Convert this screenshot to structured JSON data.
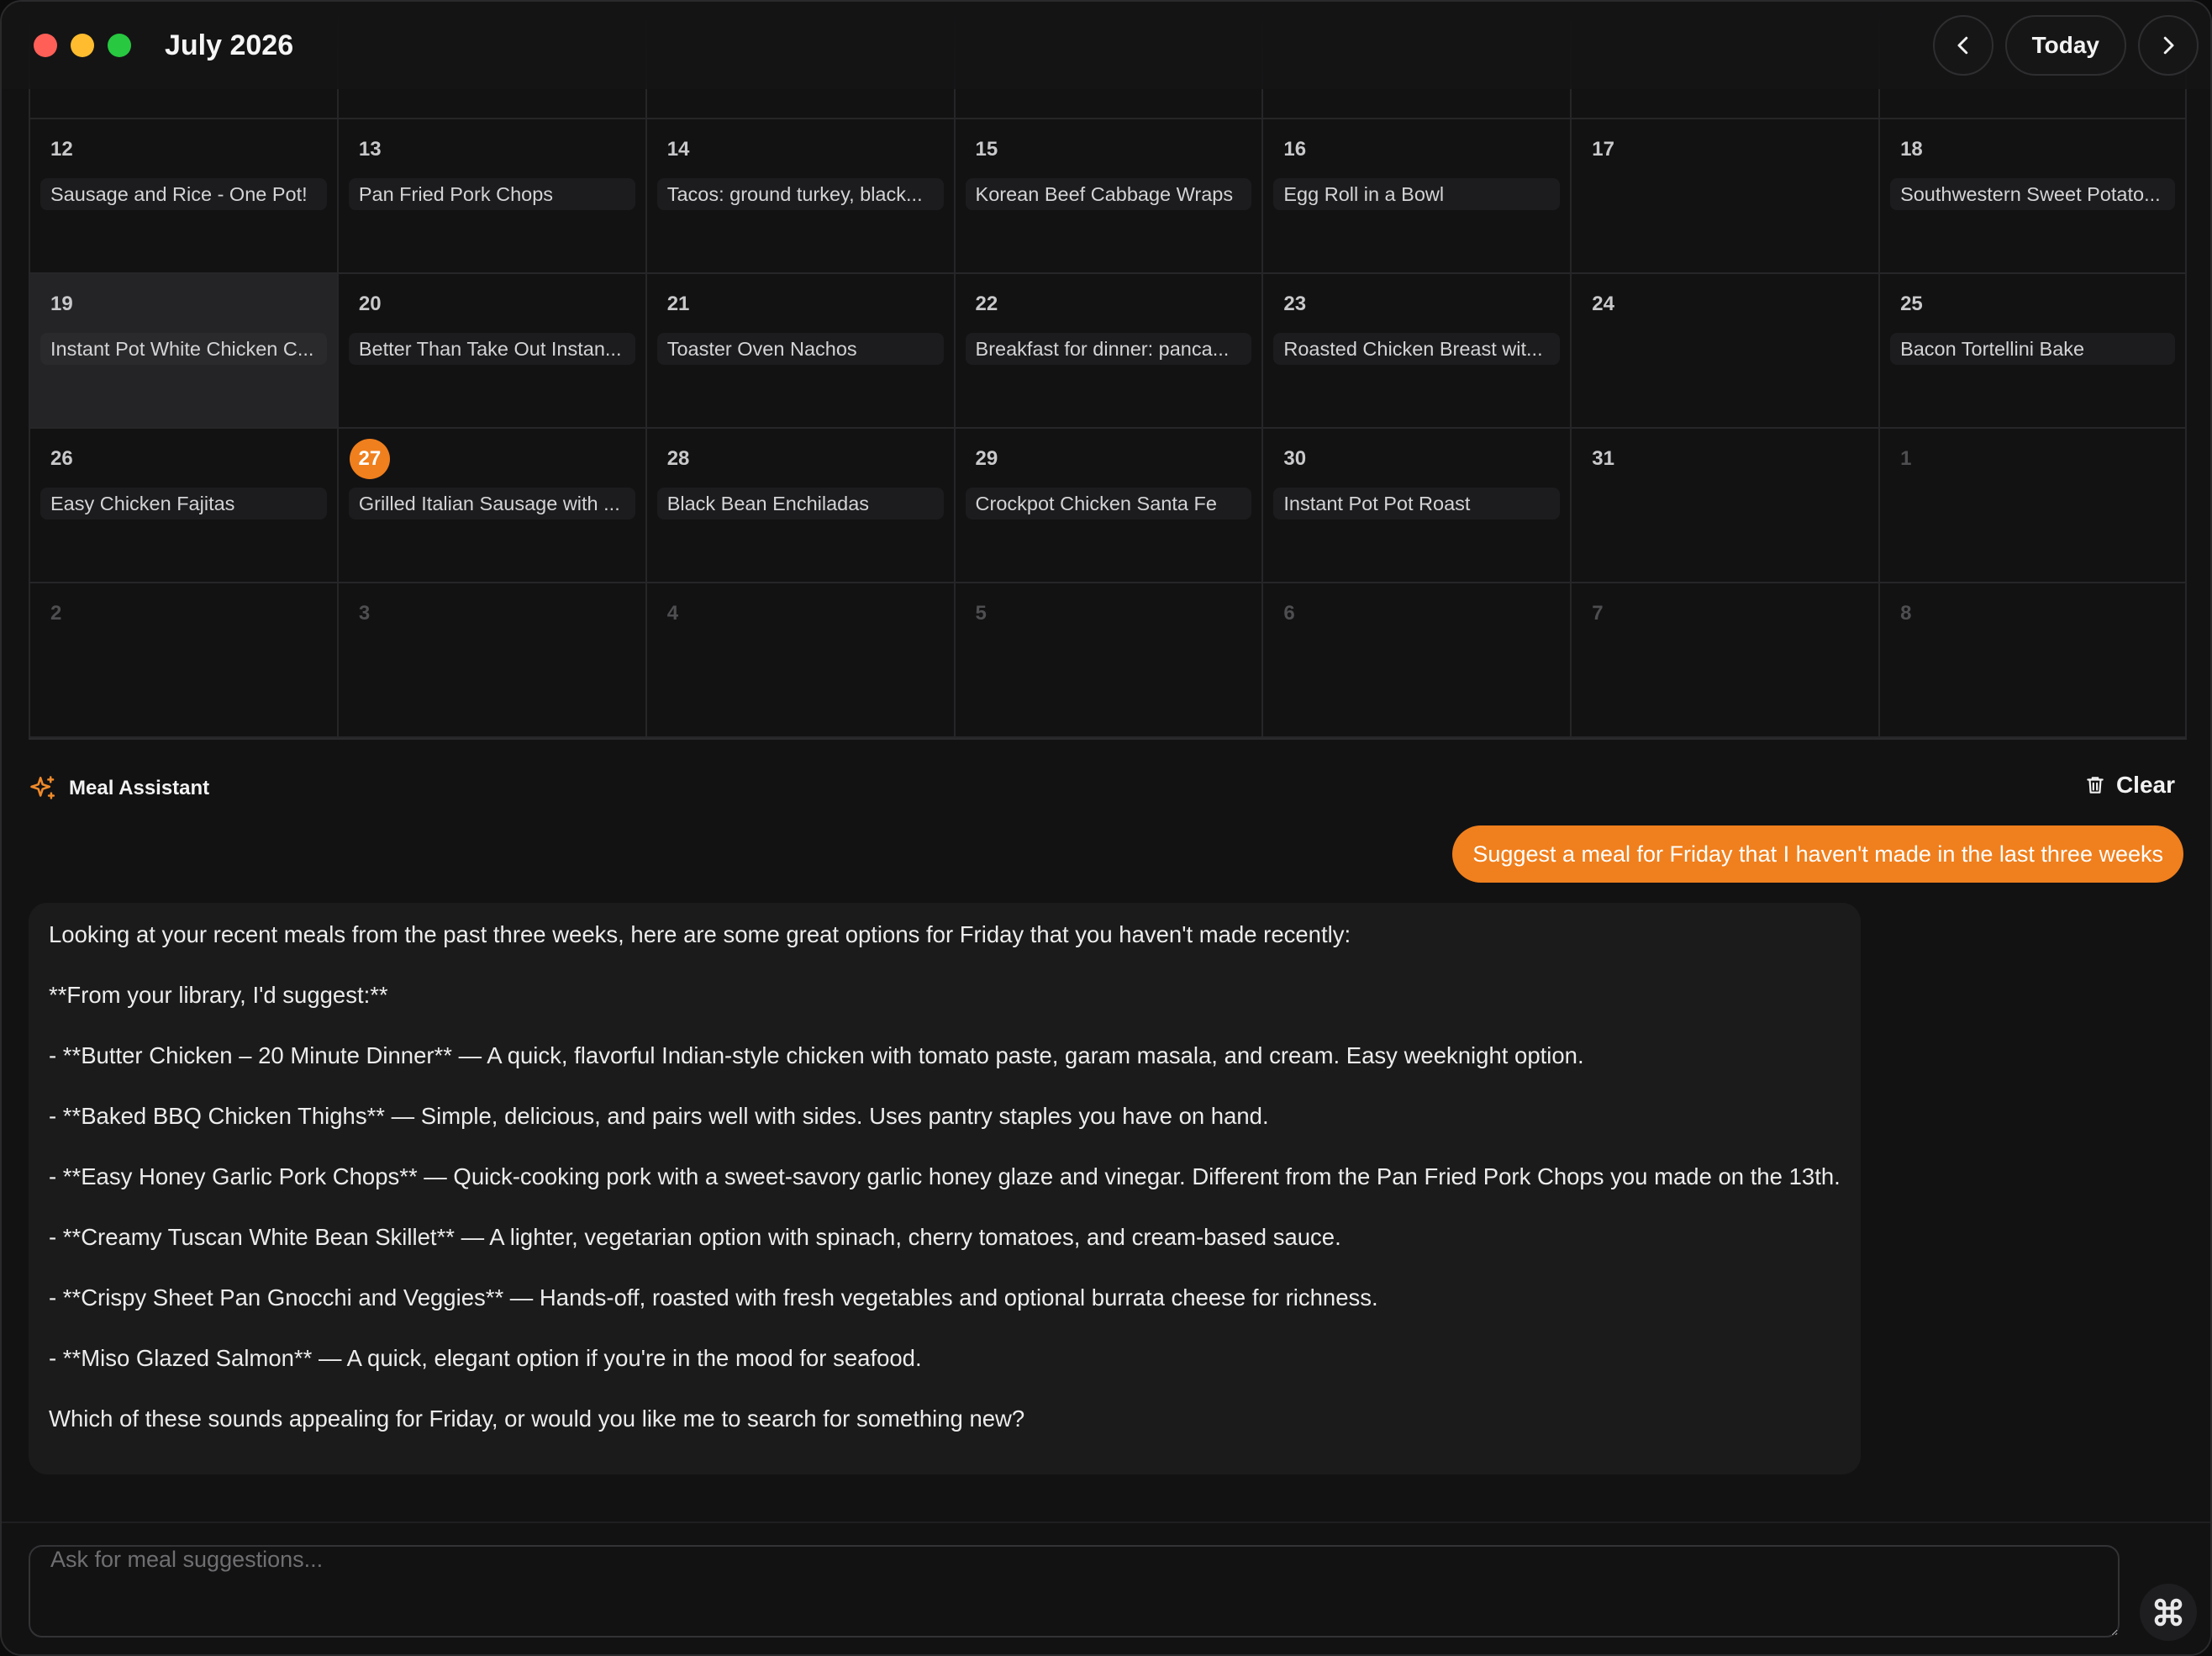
{
  "header": {
    "month_title": "July 2026",
    "today_label": "Today"
  },
  "calendar": {
    "weeks": [
      {
        "days": [
          {
            "num": "",
            "meal": ""
          },
          {
            "num": "",
            "meal": ""
          },
          {
            "num": "",
            "meal": ""
          },
          {
            "num": "",
            "meal": ""
          },
          {
            "num": "",
            "meal": ""
          },
          {
            "num": "",
            "meal": ""
          },
          {
            "num": "",
            "meal": ""
          }
        ]
      },
      {
        "days": [
          {
            "num": "12",
            "meal": "Sausage and Rice - One Pot!"
          },
          {
            "num": "13",
            "meal": "Pan Fried Pork Chops"
          },
          {
            "num": "14",
            "meal": "Tacos: ground turkey, black..."
          },
          {
            "num": "15",
            "meal": "Korean Beef Cabbage Wraps"
          },
          {
            "num": "16",
            "meal": "Egg Roll in a Bowl"
          },
          {
            "num": "17",
            "meal": ""
          },
          {
            "num": "18",
            "meal": "Southwestern Sweet Potato..."
          }
        ]
      },
      {
        "days": [
          {
            "num": "19",
            "meal": "Instant Pot White Chicken C...",
            "selected": true
          },
          {
            "num": "20",
            "meal": "Better Than Take Out Instan..."
          },
          {
            "num": "21",
            "meal": "Toaster Oven Nachos"
          },
          {
            "num": "22",
            "meal": "Breakfast for dinner: panca..."
          },
          {
            "num": "23",
            "meal": "Roasted Chicken Breast wit..."
          },
          {
            "num": "24",
            "meal": ""
          },
          {
            "num": "25",
            "meal": "Bacon Tortellini Bake"
          }
        ]
      },
      {
        "days": [
          {
            "num": "26",
            "meal": "Easy Chicken Fajitas"
          },
          {
            "num": "27",
            "meal": "Grilled Italian Sausage with ...",
            "today": true
          },
          {
            "num": "28",
            "meal": "Black Bean Enchiladas"
          },
          {
            "num": "29",
            "meal": "Crockpot Chicken Santa Fe"
          },
          {
            "num": "30",
            "meal": "Instant Pot Pot Roast"
          },
          {
            "num": "31",
            "meal": ""
          },
          {
            "num": "1",
            "meal": "",
            "muted": true
          }
        ]
      },
      {
        "days": [
          {
            "num": "2",
            "meal": "",
            "muted": true
          },
          {
            "num": "3",
            "meal": "",
            "muted": true
          },
          {
            "num": "4",
            "meal": "",
            "muted": true
          },
          {
            "num": "5",
            "meal": "",
            "muted": true
          },
          {
            "num": "6",
            "meal": "",
            "muted": true
          },
          {
            "num": "7",
            "meal": "",
            "muted": true
          },
          {
            "num": "8",
            "meal": "",
            "muted": true
          }
        ]
      }
    ]
  },
  "assistant": {
    "title": "Meal Assistant",
    "clear_label": "Clear",
    "user_message": "Suggest a meal for Friday that I haven't made in the last three weeks",
    "reply_paragraphs": [
      "Looking at your recent meals from the past three weeks, here are some great options for Friday that you haven't made recently:",
      "**From your library, I'd suggest:**",
      "- **Butter Chicken – 20 Minute Dinner** — A quick, flavorful Indian-style chicken with tomato paste, garam masala, and cream. Easy weeknight option.",
      "- **Baked BBQ Chicken Thighs** — Simple, delicious, and pairs well with sides. Uses pantry staples you have on hand.",
      "- **Easy Honey Garlic Pork Chops** — Quick-cooking pork with a sweet-savory garlic honey glaze and vinegar. Different from the Pan Fried Pork Chops you made on the 13th.",
      "- **Creamy Tuscan White Bean Skillet** — A lighter, vegetarian option with spinach, cherry tomatoes, and cream-based sauce.",
      "- **Crispy Sheet Pan Gnocchi and Veggies** — Hands-off, roasted with fresh vegetables and optional burrata cheese for richness.",
      "- **Miso Glazed Salmon** — A quick, elegant option if you're in the mood for seafood.",
      "Which of these sounds appealing for Friday, or would you like me to search for something new?"
    ]
  },
  "composer": {
    "placeholder": "Ask for meal suggestions...",
    "value": ""
  },
  "colors": {
    "accent": "#f07f1d",
    "background": "#121213",
    "traffic_red": "#ff5f57",
    "traffic_yellow": "#febc2e",
    "traffic_green": "#28c840"
  },
  "icons": {
    "prev": "chevron-left-icon",
    "next": "chevron-right-icon",
    "assistant": "sparkle-icon",
    "clear": "trash-icon",
    "fab": "command-icon"
  }
}
